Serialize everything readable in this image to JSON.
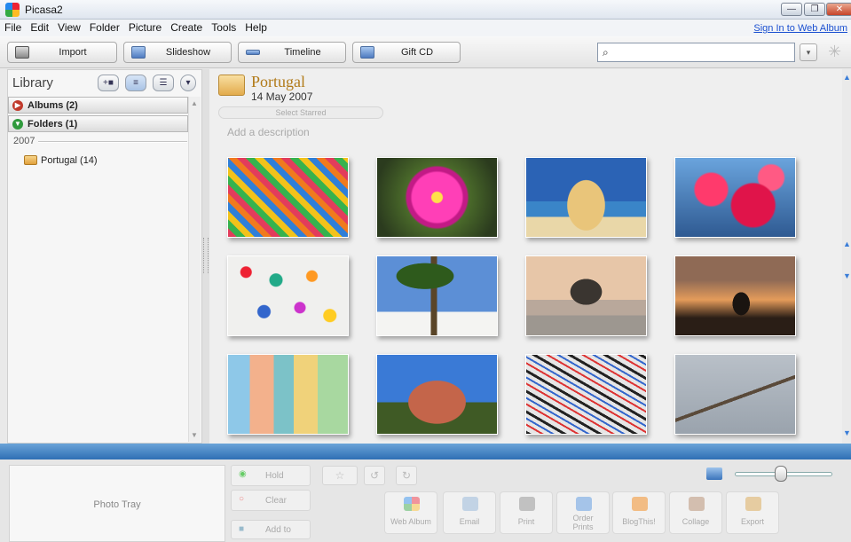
{
  "window": {
    "title": "Picasa2",
    "min": "—",
    "max": "❐",
    "close": "✕"
  },
  "menu": {
    "items": [
      "File",
      "Edit",
      "View",
      "Folder",
      "Picture",
      "Create",
      "Tools",
      "Help"
    ],
    "sign_in": "Sign In to Web Album"
  },
  "toolbar": {
    "import": "Import",
    "slideshow": "Slideshow",
    "timeline": "Timeline",
    "gift_cd": "Gift CD",
    "search_placeholder": "",
    "search_options": "▾"
  },
  "library": {
    "title": "Library",
    "albums": "Albums (2)",
    "folders": "Folders (1)",
    "year": "2007",
    "folder_item": "Portugal (14)"
  },
  "album": {
    "title": "Portugal",
    "date": "14 May 2007",
    "select_starred": "Select Starred",
    "add_description": "Add a description"
  },
  "tray": {
    "photo_tray": "Photo Tray",
    "hold": "Hold",
    "clear": "Clear",
    "add_to": "Add to",
    "actions": [
      "Web Album",
      "Email",
      "Print",
      "Order Prints",
      "BlogThis!",
      "Collage",
      "Export"
    ]
  }
}
